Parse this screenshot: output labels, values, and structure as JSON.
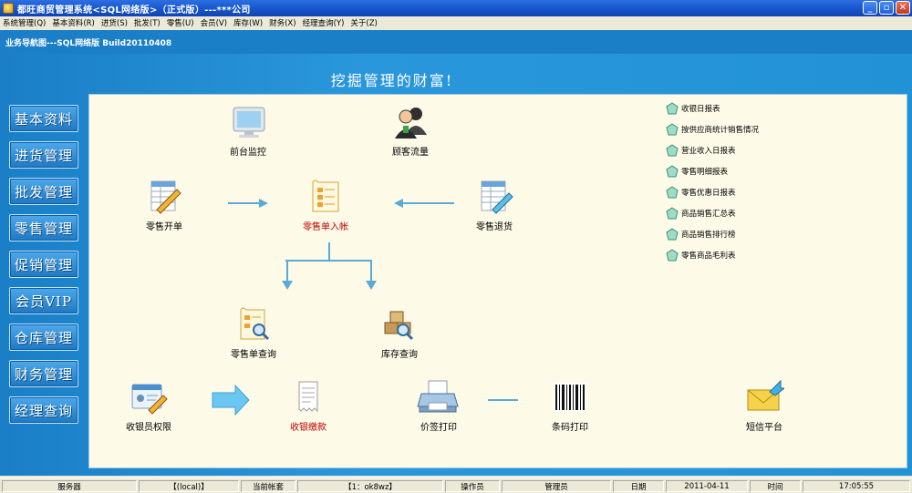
{
  "window": {
    "title": "都旺商贸管理系统<SQL网络版>（正式版）---***公司",
    "minimize": "_",
    "maximize": "▫",
    "close": "✕"
  },
  "menu": [
    "系统管理(Q)",
    "基本资料(R)",
    "进货(S)",
    "批发(T)",
    "零售(U)",
    "会员(V)",
    "库存(W)",
    "财务(X)",
    "经理查询(Y)",
    "关于(Z)"
  ],
  "nav_caption": "业务导航图---SQL网络版 Build20110408",
  "slogan": "挖掘管理的财富!",
  "sidebar": [
    "基本资料",
    "进货管理",
    "批发管理",
    "零售管理",
    "促销管理",
    "会员VIP",
    "仓库管理",
    "财务管理",
    "经理查询"
  ],
  "flow": {
    "front_monitor": "前台监控",
    "customer_flow": "顾客流量",
    "retail_order": "零售开单",
    "retail_post": "零售单入帐",
    "retail_return": "零售退货",
    "retail_query": "零售单查询",
    "stock_query": "库存查询",
    "cashier_perm": "收银员权限",
    "cash_payment": "收银缴款",
    "price_print": "价签打印",
    "barcode_print": "条码打印",
    "sms": "短信平台"
  },
  "reports": [
    "收银日报表",
    "按供应商统计销售情况",
    "营业收入日报表",
    "零售明细报表",
    "零售优惠日报表",
    "商品销售汇总表",
    "商品销售排行榜",
    "零售商品毛利表"
  ],
  "status": {
    "server_label": "服务器",
    "server_value": "【(local)】",
    "account_label": "当前帐套",
    "account_value": "【1：ok8wz】",
    "operator_label": "操作员",
    "operator_value": "管理员",
    "date_label": "日期",
    "date_value": "2011-04-11",
    "time_label": "时间",
    "time_value": "17:05:55"
  }
}
